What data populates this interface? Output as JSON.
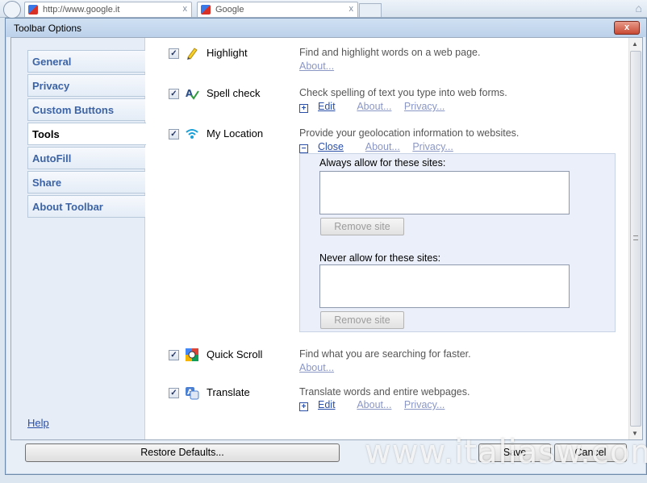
{
  "browser": {
    "tabs": [
      {
        "label": "http://www.google.it",
        "close": "x"
      },
      {
        "label": "Google",
        "close": "x"
      }
    ]
  },
  "dialog": {
    "title": "Toolbar Options",
    "close_label": "x"
  },
  "sidebar": {
    "items": [
      {
        "label": "General"
      },
      {
        "label": "Privacy"
      },
      {
        "label": "Custom Buttons"
      },
      {
        "label": "Tools",
        "active": true
      },
      {
        "label": "AutoFill"
      },
      {
        "label": "Share"
      },
      {
        "label": "About Toolbar"
      }
    ],
    "help_label": "Help"
  },
  "tools": [
    {
      "name": "Highlight",
      "checked": true,
      "icon": "highlighter-icon",
      "description": "Find and highlight words on a web page.",
      "links": [
        "About..."
      ]
    },
    {
      "name": "Spell check",
      "checked": true,
      "icon": "spellcheck-icon",
      "description": "Check spelling of text you type into web forms.",
      "links": [
        "Edit",
        "About...",
        "Privacy..."
      ]
    },
    {
      "name": "My Location",
      "checked": true,
      "icon": "wifi-location-icon",
      "description": "Provide your geolocation information to websites.",
      "links": [
        "Close",
        "About...",
        "Privacy..."
      ]
    },
    {
      "name": "Quick Scroll",
      "checked": true,
      "icon": "quick-scroll-icon",
      "description": "Find what you are searching for faster.",
      "links": [
        "About..."
      ]
    },
    {
      "name": "Translate",
      "checked": true,
      "icon": "translate-icon",
      "description": "Translate words and entire webpages.",
      "links": [
        "Edit",
        "About...",
        "Privacy..."
      ]
    }
  ],
  "location_panel": {
    "always_label": "Always allow for these sites:",
    "never_label": "Never allow for these sites:",
    "remove_label": "Remove site"
  },
  "footer": {
    "restore_label": "Restore Defaults...",
    "save_label": "Save",
    "cancel_label": "Cancel"
  },
  "watermark": "www.italiasw.com",
  "colors": {
    "link": "#2a4fa8",
    "link_faint": "#8a96c4",
    "accent": "#3b63a6"
  }
}
